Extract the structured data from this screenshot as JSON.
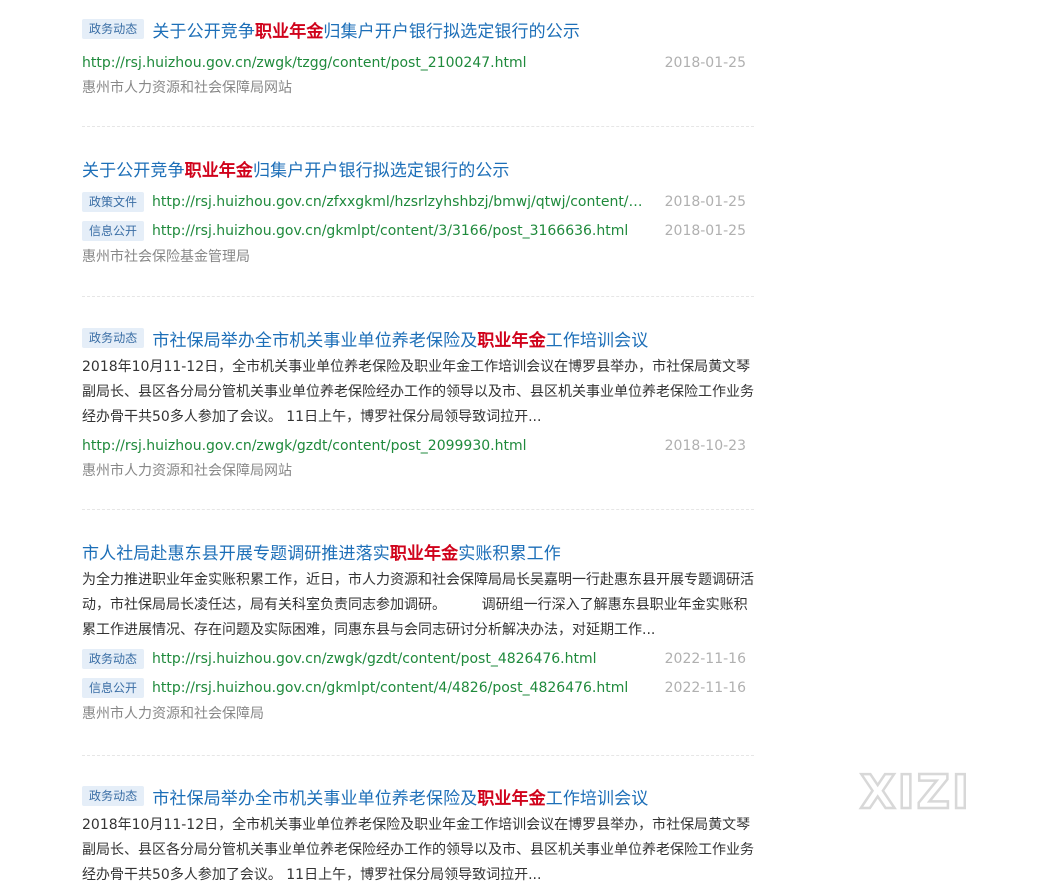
{
  "results": [
    {
      "title_pre": "关于公开竞争",
      "title_hl": "职业年金",
      "title_post": "归集户开户银行拟选定银行的公示",
      "title_tag": "政务动态",
      "snippet": "",
      "links": [
        {
          "tag": "",
          "url": "http://rsj.huizhou.gov.cn/zwgk/tzgg/content/post_2100247.html",
          "date": "2018-01-25"
        }
      ],
      "source": "惠州市人力资源和社会保障局网站"
    },
    {
      "title_pre": "关于公开竞争",
      "title_hl": "职业年金",
      "title_post": "归集户开户银行拟选定银行的公示",
      "title_tag": "",
      "snippet": "",
      "links": [
        {
          "tag": "政策文件",
          "url": "http://rsj.huizhou.gov.cn/zfxxgkml/hzsrlzyhshbzj/bmwj/qtwj/content/post...",
          "date": "2018-01-25"
        },
        {
          "tag": "信息公开",
          "url": "http://rsj.huizhou.gov.cn/gkmlpt/content/3/3166/post_3166636.html",
          "date": "2018-01-25"
        }
      ],
      "source": "惠州市社会保险基金管理局"
    },
    {
      "title_pre": "市社保局举办全市机关事业单位养老保险及",
      "title_hl": "职业年金",
      "title_post": "工作培训会议",
      "title_tag": "政务动态",
      "snippet": "2018年10月11-12日，全市机关事业单位养老保险及职业年金工作培训会议在博罗县举办，市社保局黄文琴副局长、县区各分局分管机关事业单位养老保险经办工作的领导以及市、县区机关事业单位养老保险工作业务经办骨干共50多人参加了会议。 11日上午，博罗社保分局领导致词拉开...",
      "links": [
        {
          "tag": "",
          "url": "http://rsj.huizhou.gov.cn/zwgk/gzdt/content/post_2099930.html",
          "date": "2018-10-23"
        }
      ],
      "source": "惠州市人力资源和社会保障局网站"
    },
    {
      "title_pre": "市人社局赴惠东县开展专题调研推进落实",
      "title_hl": "职业年金",
      "title_post": "实账积累工作",
      "title_tag": "",
      "snippet": "为全力推进职业年金实账积累工作，近日，市人力资源和社会保障局局长吴嘉明一行赴惠东县开展专题调研活动，市社保局局长凌任达，局有关科室负责同志参加调研。        调研组一行深入了解惠东县职业年金实账积累工作进展情况、存在问题及实际困难，同惠东县与会同志研讨分析解决办法，对延期工作...",
      "links": [
        {
          "tag": "政务动态",
          "url": "http://rsj.huizhou.gov.cn/zwgk/gzdt/content/post_4826476.html",
          "date": "2022-11-16"
        },
        {
          "tag": "信息公开",
          "url": "http://rsj.huizhou.gov.cn/gkmlpt/content/4/4826/post_4826476.html",
          "date": "2022-11-16"
        }
      ],
      "source": "惠州市人力资源和社会保障局"
    },
    {
      "title_pre": "市社保局举办全市机关事业单位养老保险及",
      "title_hl": "职业年金",
      "title_post": "工作培训会议",
      "title_tag": "政务动态",
      "snippet": "2018年10月11-12日，全市机关事业单位养老保险及职业年金工作培训会议在博罗县举办，市社保局黄文琴副局长、县区各分局分管机关事业单位养老保险经办工作的领导以及市、县区机关事业单位养老保险工作业务经办骨干共50多人参加了会议。 11日上午，博罗社保分局领导致词拉开...",
      "links": [],
      "source": ""
    }
  ],
  "watermark": "XIZI"
}
